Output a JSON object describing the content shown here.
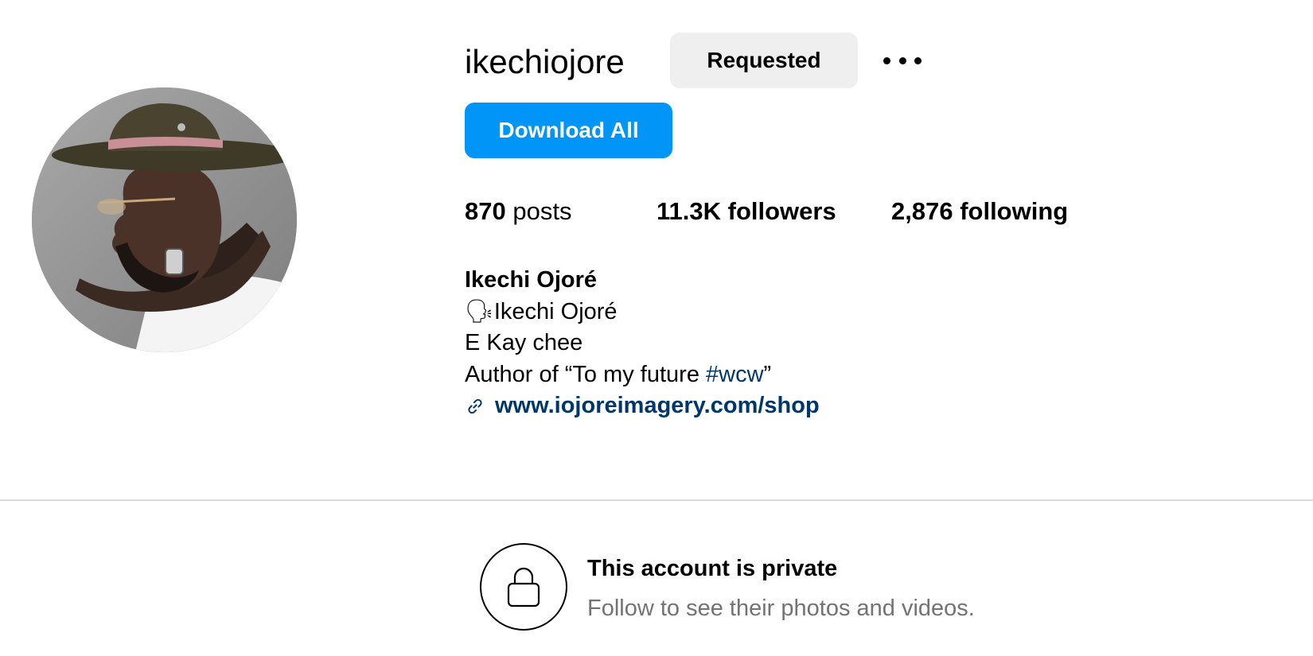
{
  "profile": {
    "username": "ikechiojore",
    "requested_label": "Requested",
    "more_icon": "more-horizontal-icon",
    "download_label": "Download All",
    "avatar_icon": "profile-photo"
  },
  "stats": {
    "posts_count": "870",
    "posts_label": " posts",
    "followers_count": "11.3K",
    "followers_label": " followers",
    "following_count": "2,876",
    "following_label": " following"
  },
  "bio": {
    "name": "Ikechi Ojoré",
    "line1": "🗣Ikechi Ojoré",
    "line2": "E Kay chee",
    "line3_prefix": "Author of “To my future ",
    "line3_hashtag": "#wcw",
    "line3_suffix": "”",
    "link_icon": "link-icon",
    "link": "www.iojoreimagery.com/shop"
  },
  "private": {
    "icon": "lock-icon",
    "title": "This account is private",
    "subtitle": "Follow to see their photos and videos."
  },
  "colors": {
    "primary_button": "#0095f6",
    "secondary_button": "#efefef",
    "link": "#00376b",
    "muted_text": "#737373",
    "divider": "#dbdbdb"
  }
}
